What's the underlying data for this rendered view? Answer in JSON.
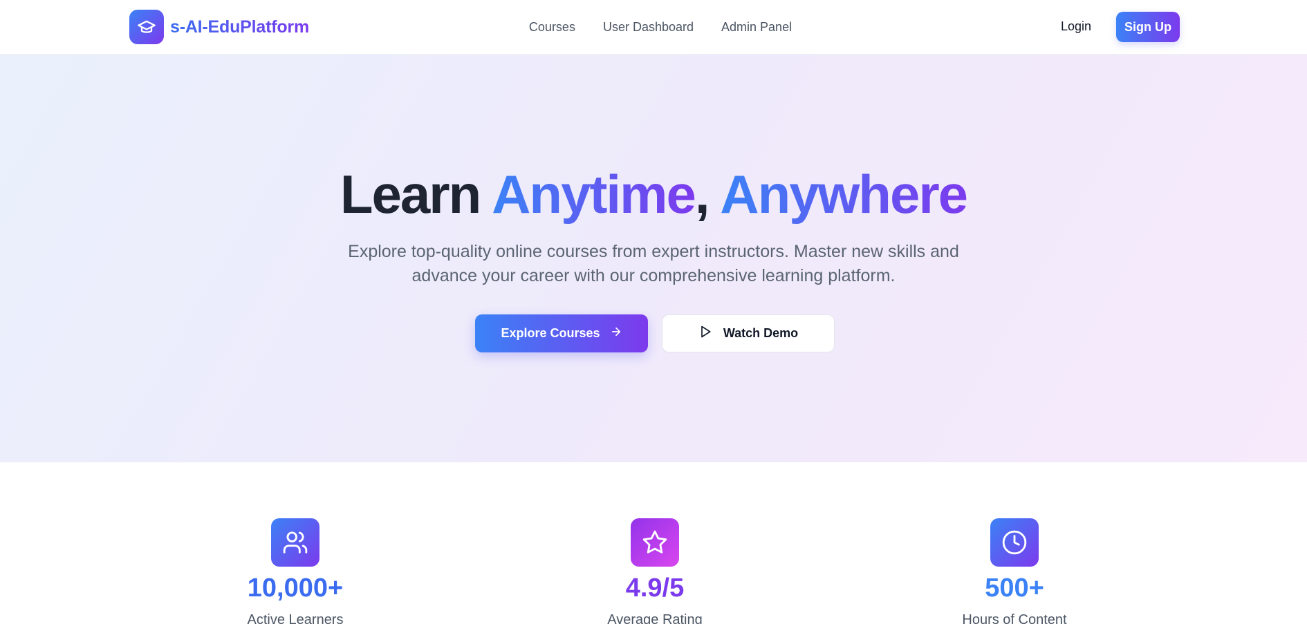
{
  "header": {
    "brand": "s-AI-EduPlatform",
    "logo_icon": "graduation-cap-icon",
    "nav": [
      {
        "label": "Courses"
      },
      {
        "label": "User Dashboard"
      },
      {
        "label": "Admin Panel"
      }
    ],
    "login_label": "Login",
    "signup_label": "Sign Up"
  },
  "hero": {
    "title_plain": "Learn ",
    "title_accent_1": "Anytime",
    "title_comma": ", ",
    "title_accent_2": "Anywhere",
    "subtitle": "Explore top-quality online courses from expert instructors. Master new skills and advance your career with our comprehensive learning platform.",
    "primary_cta": "Explore Courses",
    "primary_cta_icon": "arrow-right-icon",
    "secondary_cta": "Watch Demo",
    "secondary_cta_icon": "play-icon"
  },
  "stats": [
    {
      "icon": "users-icon",
      "value": "10,000+",
      "label": "Active Learners",
      "color": "#3b6cf0"
    },
    {
      "icon": "star-icon",
      "value": "4.9/5",
      "label": "Average Rating",
      "color": "#7c3aed"
    },
    {
      "icon": "clock-icon",
      "value": "500+",
      "label": "Hours of Content",
      "color": "#3b82f6"
    }
  ],
  "colors": {
    "brand_start": "#3b82f6",
    "brand_end": "#7c3aed",
    "stat_pink_start": "#9333ea",
    "stat_pink_end": "#d946ef"
  }
}
